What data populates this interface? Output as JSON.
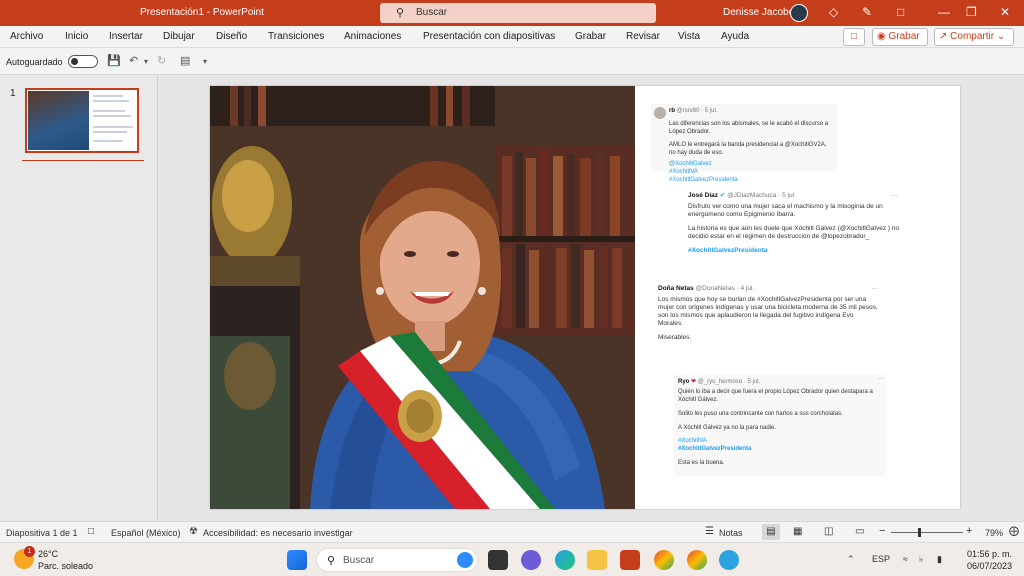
{
  "titlebar": {
    "title": "Presentación1  -  PowerPoint",
    "search_placeholder": "Buscar",
    "user_name": "Denisse Jacobo"
  },
  "menu": {
    "items": [
      "Archivo",
      "Inicio",
      "Insertar",
      "Dibujar",
      "Diseño",
      "Transiciones",
      "Animaciones",
      "Presentación con diapositivas",
      "Grabar",
      "Revisar",
      "Vista",
      "Ayuda"
    ],
    "record_button": "Grabar",
    "share_button": "Compartir"
  },
  "qat": {
    "autosave_label": "Autoguardado"
  },
  "thumbnails": {
    "slide_number": "1"
  },
  "tweets": [
    {
      "name": "rb",
      "handle": "@rsrv80 · 5 jul.",
      "lines": [
        "Las diferencias son los abismales, se le acabó el discurso a López Obrador.",
        "AMLO le entregará la  banda presidencial a @XochitlGV2A, no hay duda de eso."
      ],
      "tags": [
        "@XochitlGalvez",
        "#XochitlVA",
        "#XochitlGalvezPresidenta"
      ]
    },
    {
      "name": "José Díaz",
      "handle": "@JDiazMachuca · 5 jul.",
      "lines": [
        "Disfruto ver como una mujer saca el machismo y la misoginia de un energúmeno como Epigmenio Ibarra.",
        "La historia es que aún les duele que Xóchitl Gálvez (@XochitlGalvez ) no decidió estar en el régimen de destrucción de @lopezobrador_"
      ],
      "tags": [
        "#XochitlGalvezPresidenta"
      ]
    },
    {
      "name": "Doña Netas",
      "handle": "@DonaNetas · 4 jul.",
      "lines": [
        "Los mismos que hoy se burlan de #XochitlGalvezPresidenta por ser una mujer con orígenes indígenas y usar una bicicleta moderna de 35 mil pesos, son los mismos que aplaudieron la llegada del fugitivo indígena Evo Morales.",
        "Miserables."
      ],
      "tags": []
    },
    {
      "name": "Ryo",
      "handle": "@_ryo_hermoso · 5 jul.",
      "lines": [
        "Quién lo iba a decir que fuera el propio López Obrador quien destapara a Xóchitl Gálvez.",
        "Solito les puso una contrincante con hartos a sus corcholatas.",
        "A Xóchitl Gálvez ya no la para nadie."
      ],
      "tags": [
        "#XochitlVA",
        "#XochitlGalvezPresidenta"
      ],
      "footer": "Esta es la buena."
    }
  ],
  "status": {
    "slide_count": "Diapositiva 1 de 1",
    "language": "Español (México)",
    "accessibility": "Accesibilidad: es necesario investigar",
    "notes": "Notas",
    "zoom": "79%"
  },
  "taskbar": {
    "temperature": "26°C",
    "weather": "Parc. soleado",
    "notification_count": "1",
    "search_placeholder": "Buscar",
    "language": "ESP",
    "time": "01:56 p. m.",
    "date": "06/07/2023"
  },
  "colors": {
    "accent": "#c43e1c",
    "link": "#1d9bf0"
  }
}
